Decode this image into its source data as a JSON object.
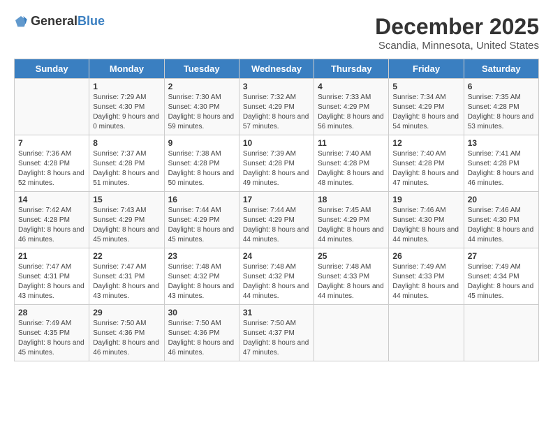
{
  "header": {
    "logo_general": "General",
    "logo_blue": "Blue",
    "title": "December 2025",
    "subtitle": "Scandia, Minnesota, United States"
  },
  "days_of_week": [
    "Sunday",
    "Monday",
    "Tuesday",
    "Wednesday",
    "Thursday",
    "Friday",
    "Saturday"
  ],
  "weeks": [
    [
      {
        "day": "",
        "sunrise": "",
        "sunset": "",
        "daylight": ""
      },
      {
        "day": "1",
        "sunrise": "Sunrise: 7:29 AM",
        "sunset": "Sunset: 4:30 PM",
        "daylight": "Daylight: 9 hours and 0 minutes."
      },
      {
        "day": "2",
        "sunrise": "Sunrise: 7:30 AM",
        "sunset": "Sunset: 4:30 PM",
        "daylight": "Daylight: 8 hours and 59 minutes."
      },
      {
        "day": "3",
        "sunrise": "Sunrise: 7:32 AM",
        "sunset": "Sunset: 4:29 PM",
        "daylight": "Daylight: 8 hours and 57 minutes."
      },
      {
        "day": "4",
        "sunrise": "Sunrise: 7:33 AM",
        "sunset": "Sunset: 4:29 PM",
        "daylight": "Daylight: 8 hours and 56 minutes."
      },
      {
        "day": "5",
        "sunrise": "Sunrise: 7:34 AM",
        "sunset": "Sunset: 4:29 PM",
        "daylight": "Daylight: 8 hours and 54 minutes."
      },
      {
        "day": "6",
        "sunrise": "Sunrise: 7:35 AM",
        "sunset": "Sunset: 4:28 PM",
        "daylight": "Daylight: 8 hours and 53 minutes."
      }
    ],
    [
      {
        "day": "7",
        "sunrise": "Sunrise: 7:36 AM",
        "sunset": "Sunset: 4:28 PM",
        "daylight": "Daylight: 8 hours and 52 minutes."
      },
      {
        "day": "8",
        "sunrise": "Sunrise: 7:37 AM",
        "sunset": "Sunset: 4:28 PM",
        "daylight": "Daylight: 8 hours and 51 minutes."
      },
      {
        "day": "9",
        "sunrise": "Sunrise: 7:38 AM",
        "sunset": "Sunset: 4:28 PM",
        "daylight": "Daylight: 8 hours and 50 minutes."
      },
      {
        "day": "10",
        "sunrise": "Sunrise: 7:39 AM",
        "sunset": "Sunset: 4:28 PM",
        "daylight": "Daylight: 8 hours and 49 minutes."
      },
      {
        "day": "11",
        "sunrise": "Sunrise: 7:40 AM",
        "sunset": "Sunset: 4:28 PM",
        "daylight": "Daylight: 8 hours and 48 minutes."
      },
      {
        "day": "12",
        "sunrise": "Sunrise: 7:40 AM",
        "sunset": "Sunset: 4:28 PM",
        "daylight": "Daylight: 8 hours and 47 minutes."
      },
      {
        "day": "13",
        "sunrise": "Sunrise: 7:41 AM",
        "sunset": "Sunset: 4:28 PM",
        "daylight": "Daylight: 8 hours and 46 minutes."
      }
    ],
    [
      {
        "day": "14",
        "sunrise": "Sunrise: 7:42 AM",
        "sunset": "Sunset: 4:28 PM",
        "daylight": "Daylight: 8 hours and 46 minutes."
      },
      {
        "day": "15",
        "sunrise": "Sunrise: 7:43 AM",
        "sunset": "Sunset: 4:29 PM",
        "daylight": "Daylight: 8 hours and 45 minutes."
      },
      {
        "day": "16",
        "sunrise": "Sunrise: 7:44 AM",
        "sunset": "Sunset: 4:29 PM",
        "daylight": "Daylight: 8 hours and 45 minutes."
      },
      {
        "day": "17",
        "sunrise": "Sunrise: 7:44 AM",
        "sunset": "Sunset: 4:29 PM",
        "daylight": "Daylight: 8 hours and 44 minutes."
      },
      {
        "day": "18",
        "sunrise": "Sunrise: 7:45 AM",
        "sunset": "Sunset: 4:29 PM",
        "daylight": "Daylight: 8 hours and 44 minutes."
      },
      {
        "day": "19",
        "sunrise": "Sunrise: 7:46 AM",
        "sunset": "Sunset: 4:30 PM",
        "daylight": "Daylight: 8 hours and 44 minutes."
      },
      {
        "day": "20",
        "sunrise": "Sunrise: 7:46 AM",
        "sunset": "Sunset: 4:30 PM",
        "daylight": "Daylight: 8 hours and 44 minutes."
      }
    ],
    [
      {
        "day": "21",
        "sunrise": "Sunrise: 7:47 AM",
        "sunset": "Sunset: 4:31 PM",
        "daylight": "Daylight: 8 hours and 43 minutes."
      },
      {
        "day": "22",
        "sunrise": "Sunrise: 7:47 AM",
        "sunset": "Sunset: 4:31 PM",
        "daylight": "Daylight: 8 hours and 43 minutes."
      },
      {
        "day": "23",
        "sunrise": "Sunrise: 7:48 AM",
        "sunset": "Sunset: 4:32 PM",
        "daylight": "Daylight: 8 hours and 43 minutes."
      },
      {
        "day": "24",
        "sunrise": "Sunrise: 7:48 AM",
        "sunset": "Sunset: 4:32 PM",
        "daylight": "Daylight: 8 hours and 44 minutes."
      },
      {
        "day": "25",
        "sunrise": "Sunrise: 7:48 AM",
        "sunset": "Sunset: 4:33 PM",
        "daylight": "Daylight: 8 hours and 44 minutes."
      },
      {
        "day": "26",
        "sunrise": "Sunrise: 7:49 AM",
        "sunset": "Sunset: 4:33 PM",
        "daylight": "Daylight: 8 hours and 44 minutes."
      },
      {
        "day": "27",
        "sunrise": "Sunrise: 7:49 AM",
        "sunset": "Sunset: 4:34 PM",
        "daylight": "Daylight: 8 hours and 45 minutes."
      }
    ],
    [
      {
        "day": "28",
        "sunrise": "Sunrise: 7:49 AM",
        "sunset": "Sunset: 4:35 PM",
        "daylight": "Daylight: 8 hours and 45 minutes."
      },
      {
        "day": "29",
        "sunrise": "Sunrise: 7:50 AM",
        "sunset": "Sunset: 4:36 PM",
        "daylight": "Daylight: 8 hours and 46 minutes."
      },
      {
        "day": "30",
        "sunrise": "Sunrise: 7:50 AM",
        "sunset": "Sunset: 4:36 PM",
        "daylight": "Daylight: 8 hours and 46 minutes."
      },
      {
        "day": "31",
        "sunrise": "Sunrise: 7:50 AM",
        "sunset": "Sunset: 4:37 PM",
        "daylight": "Daylight: 8 hours and 47 minutes."
      },
      {
        "day": "",
        "sunrise": "",
        "sunset": "",
        "daylight": ""
      },
      {
        "day": "",
        "sunrise": "",
        "sunset": "",
        "daylight": ""
      },
      {
        "day": "",
        "sunrise": "",
        "sunset": "",
        "daylight": ""
      }
    ]
  ]
}
